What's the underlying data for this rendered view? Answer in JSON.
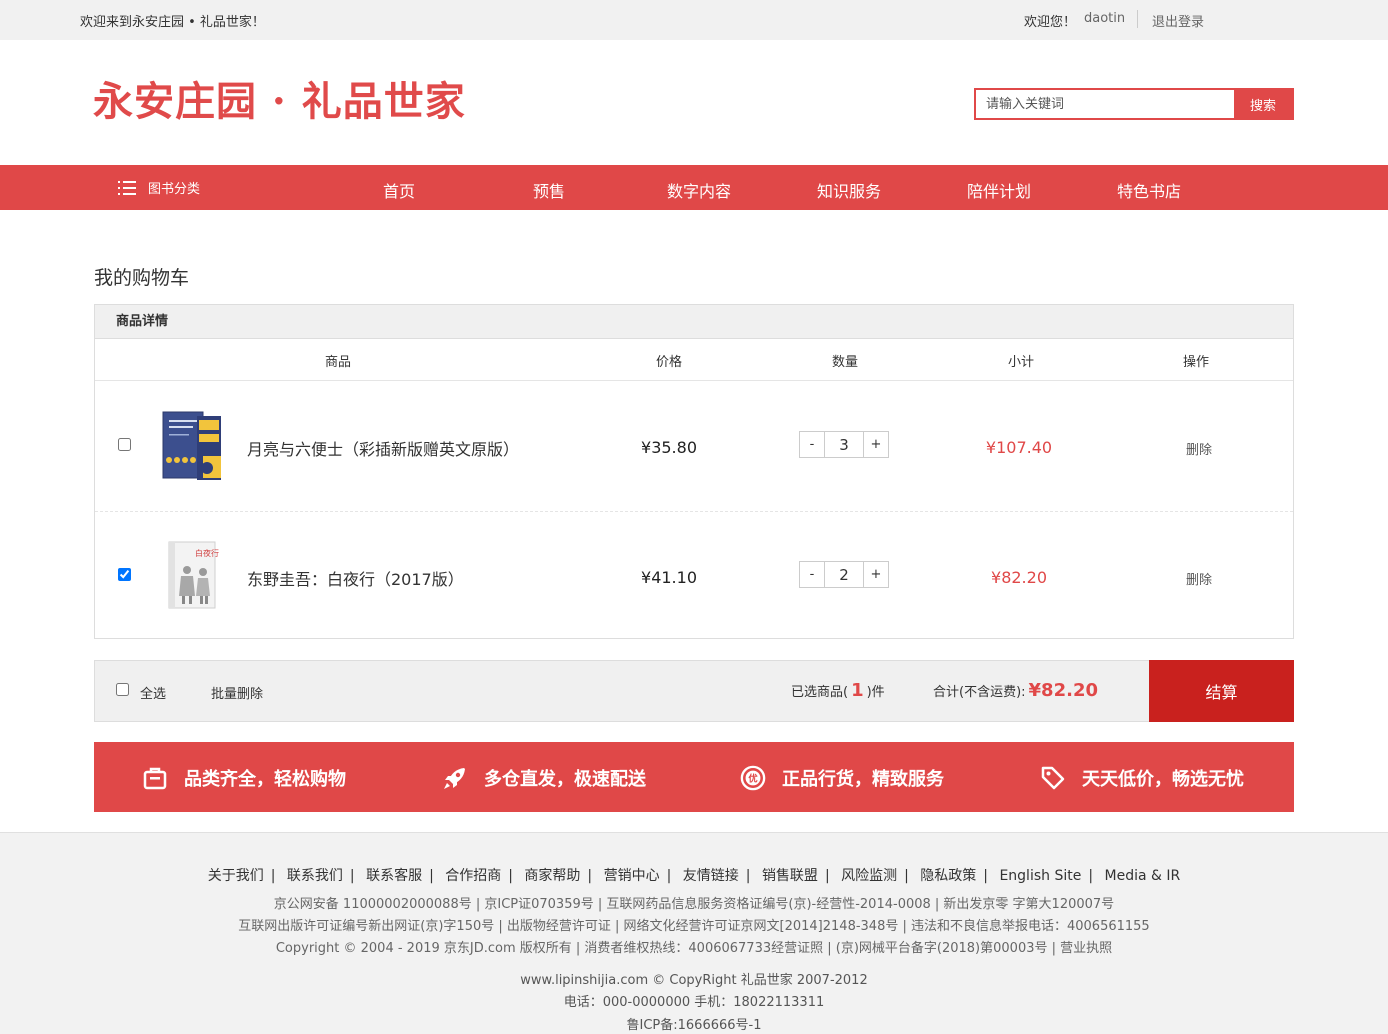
{
  "topbar": {
    "welcome": "欢迎来到永安庄园 • 礼品世家！",
    "greeting": "欢迎您！",
    "username": "daotin",
    "logout": "退出登录"
  },
  "header": {
    "logo": "永安庄园 · 礼品世家",
    "search_placeholder": "请输入关键词",
    "search_button": "搜索"
  },
  "nav": {
    "category_label": "图书分类",
    "items": [
      "首页",
      "预售",
      "数字内容",
      "知识服务",
      "陪伴计划",
      "特色书店"
    ]
  },
  "cart": {
    "title": "我的购物车",
    "section_header": "商品详情",
    "columns": [
      "商品",
      "价格",
      "数量",
      "小计",
      "操作"
    ],
    "items": [
      {
        "name": "月亮与六便士（彩插新版赠英文原版）",
        "price": "¥35.80",
        "quantity": "3",
        "subtotal": "¥107.40",
        "action": "删除",
        "checked": false
      },
      {
        "name": "东野圭吾：白夜行（2017版）",
        "price": "¥41.10",
        "quantity": "2",
        "subtotal": "¥82.20",
        "action": "删除",
        "checked": true
      }
    ],
    "qty_minus": "-",
    "qty_plus": "+"
  },
  "summary": {
    "select_all": "全选",
    "batch_delete": "批量删除",
    "selected_prefix": "已选商品(",
    "selected_count": "1",
    "selected_suffix": ")件",
    "total_label": "合计(不含运费):",
    "total_amount": "¥82.20",
    "checkout": "结算"
  },
  "banner": {
    "features": [
      "品类齐全，轻松购物",
      "多仓直发，极速配送",
      "正品行货，精致服务",
      "天天低价，畅选无忧"
    ]
  },
  "footer": {
    "links": [
      "关于我们",
      "联系我们",
      "联系客服",
      "合作招商",
      "商家帮助",
      "营销中心",
      "友情链接",
      "销售联盟",
      "风险监测",
      "隐私政策",
      "English Site",
      "Media & IR"
    ],
    "line1": "京公网安备 11000002000088号 | 京ICP证070359号 | 互联网药品信息服务资格证编号(京)-经营性-2014-0008 | 新出发京零 字第大120007号",
    "line2": "互联网出版许可证编号新出网证(京)字150号 | 出版物经营许可证 | 网络文化经营许可证京网文[2014]2148-348号 | 违法和不良信息举报电话：4006561155",
    "line3": "Copyright © 2004 - 2019 京东JD.com 版权所有 | 消费者维权热线：4006067733经营证照 | (京)网械平台备字(2018)第00003号 | 营业执照",
    "line4": "www.lipinshijia.com © CopyRight 礼品世家 2007-2012",
    "line5": "电话：000-0000000 手机：18022113311",
    "line6": "鲁ICP备:1666666号-1"
  },
  "colors": {
    "brand_red": "#e04848",
    "checkout_red": "#c9211e"
  }
}
